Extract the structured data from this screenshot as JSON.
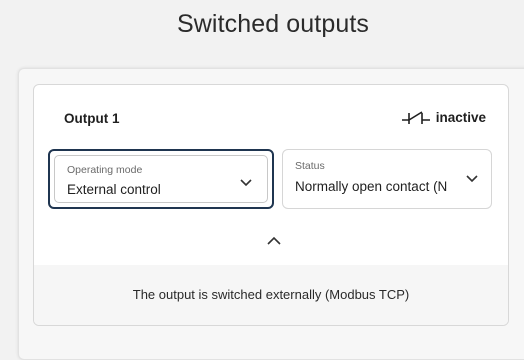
{
  "header": {
    "title": "Switched outputs"
  },
  "output": {
    "title": "Output 1",
    "state": "inactive",
    "state_icon": "switch-contact-icon"
  },
  "fields": {
    "operating_mode": {
      "label": "Operating mode",
      "value": "External control"
    },
    "status": {
      "label": "Status",
      "value": "Normally open contact (N"
    }
  },
  "toggle": {
    "icon": "chevron-up-icon"
  },
  "footer": {
    "text": "The output is switched externally (Modbus TCP)"
  },
  "colors": {
    "focus_border": "#1f3550",
    "panel_bg": "#f7f7f7",
    "card_bg": "#ffffff"
  }
}
